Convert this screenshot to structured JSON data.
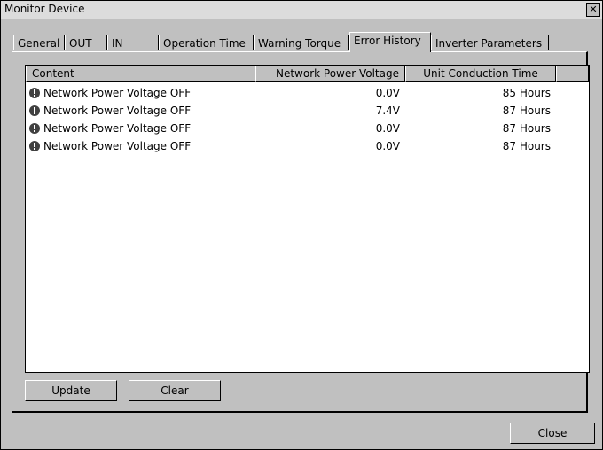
{
  "window": {
    "title": "Monitor Device",
    "close_glyph": "✕"
  },
  "tabs": [
    {
      "label": "General"
    },
    {
      "label": "OUT"
    },
    {
      "label": "IN"
    },
    {
      "label": "Operation Time"
    },
    {
      "label": "Warning Torque"
    },
    {
      "label": "Error History",
      "active": true
    },
    {
      "label": "Inverter Parameters"
    }
  ],
  "list": {
    "columns": [
      "Content",
      "Network Power Voltage",
      "Unit Conduction Time"
    ],
    "rows": [
      {
        "icon": "warning-icon",
        "content": "Network Power Voltage OFF",
        "voltage": "0.0V",
        "time": "85 Hours"
      },
      {
        "icon": "warning-icon",
        "content": "Network Power Voltage OFF",
        "voltage": "7.4V",
        "time": "87 Hours"
      },
      {
        "icon": "warning-icon",
        "content": "Network Power Voltage OFF",
        "voltage": "0.0V",
        "time": "87 Hours"
      },
      {
        "icon": "warning-icon",
        "content": "Network Power Voltage OFF",
        "voltage": "0.0V",
        "time": "87 Hours"
      }
    ]
  },
  "buttons": {
    "update": "Update",
    "clear": "Clear",
    "close": "Close"
  }
}
